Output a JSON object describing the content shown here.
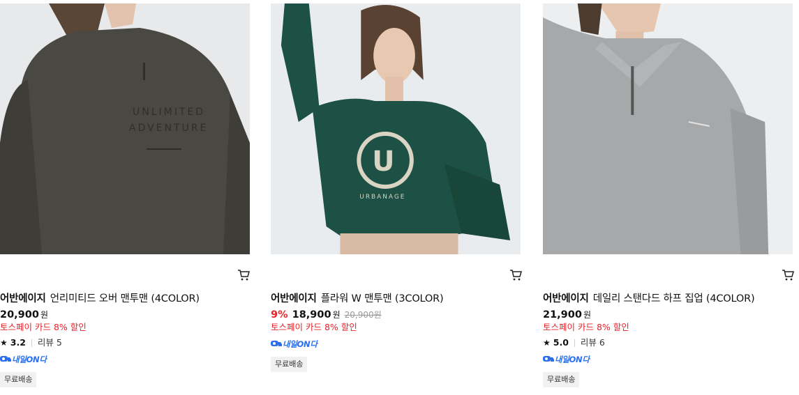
{
  "products": [
    {
      "brand": "어반에이지",
      "name": "언리미티드 오버 맨투맨 (4COLOR)",
      "discount": "",
      "price": "20,900",
      "currency": "원",
      "original_price": "",
      "promo": "토스페이 카드 8% 할인",
      "rating_star": "★",
      "rating": "3.2",
      "reviews": "리뷰 5",
      "delivery_badge": "내일ON다",
      "shipping": "무료배송",
      "image_print": "UNLIMITED ADVENTURE",
      "colors": {
        "garment": "#4a4842",
        "background": "#e7e9ea"
      }
    },
    {
      "brand": "어반에이지",
      "name": "플라워 W 맨투맨 (3COLOR)",
      "discount": "9%",
      "price": "18,900",
      "currency": "원",
      "original_price": "20,900원",
      "promo": "토스페이 카드 8% 할인",
      "rating_star": "",
      "rating": "",
      "reviews": "",
      "delivery_badge": "내일ON다",
      "shipping": "무료배송",
      "image_print": "URBANAGE",
      "colors": {
        "garment": "#1d5145",
        "background": "#e9ecee"
      }
    },
    {
      "brand": "어반에이지",
      "name": "데일리 스탠다드 하프 집업 (4COLOR)",
      "discount": "",
      "price": "21,900",
      "currency": "원",
      "original_price": "",
      "promo": "토스페이 카드 8% 할인",
      "rating_star": "★",
      "rating": "5.0",
      "reviews": "리뷰 6",
      "delivery_badge": "내일ON다",
      "shipping": "무료배송",
      "image_print": "",
      "colors": {
        "garment": "#a7a8aa",
        "background": "#eceeef"
      }
    }
  ],
  "icons": {
    "cart": "cart-icon",
    "star": "star-icon",
    "delivery": "truck-icon"
  },
  "accent": {
    "sale_red": "#e8242a",
    "delivery_blue": "#2a6ff0"
  }
}
